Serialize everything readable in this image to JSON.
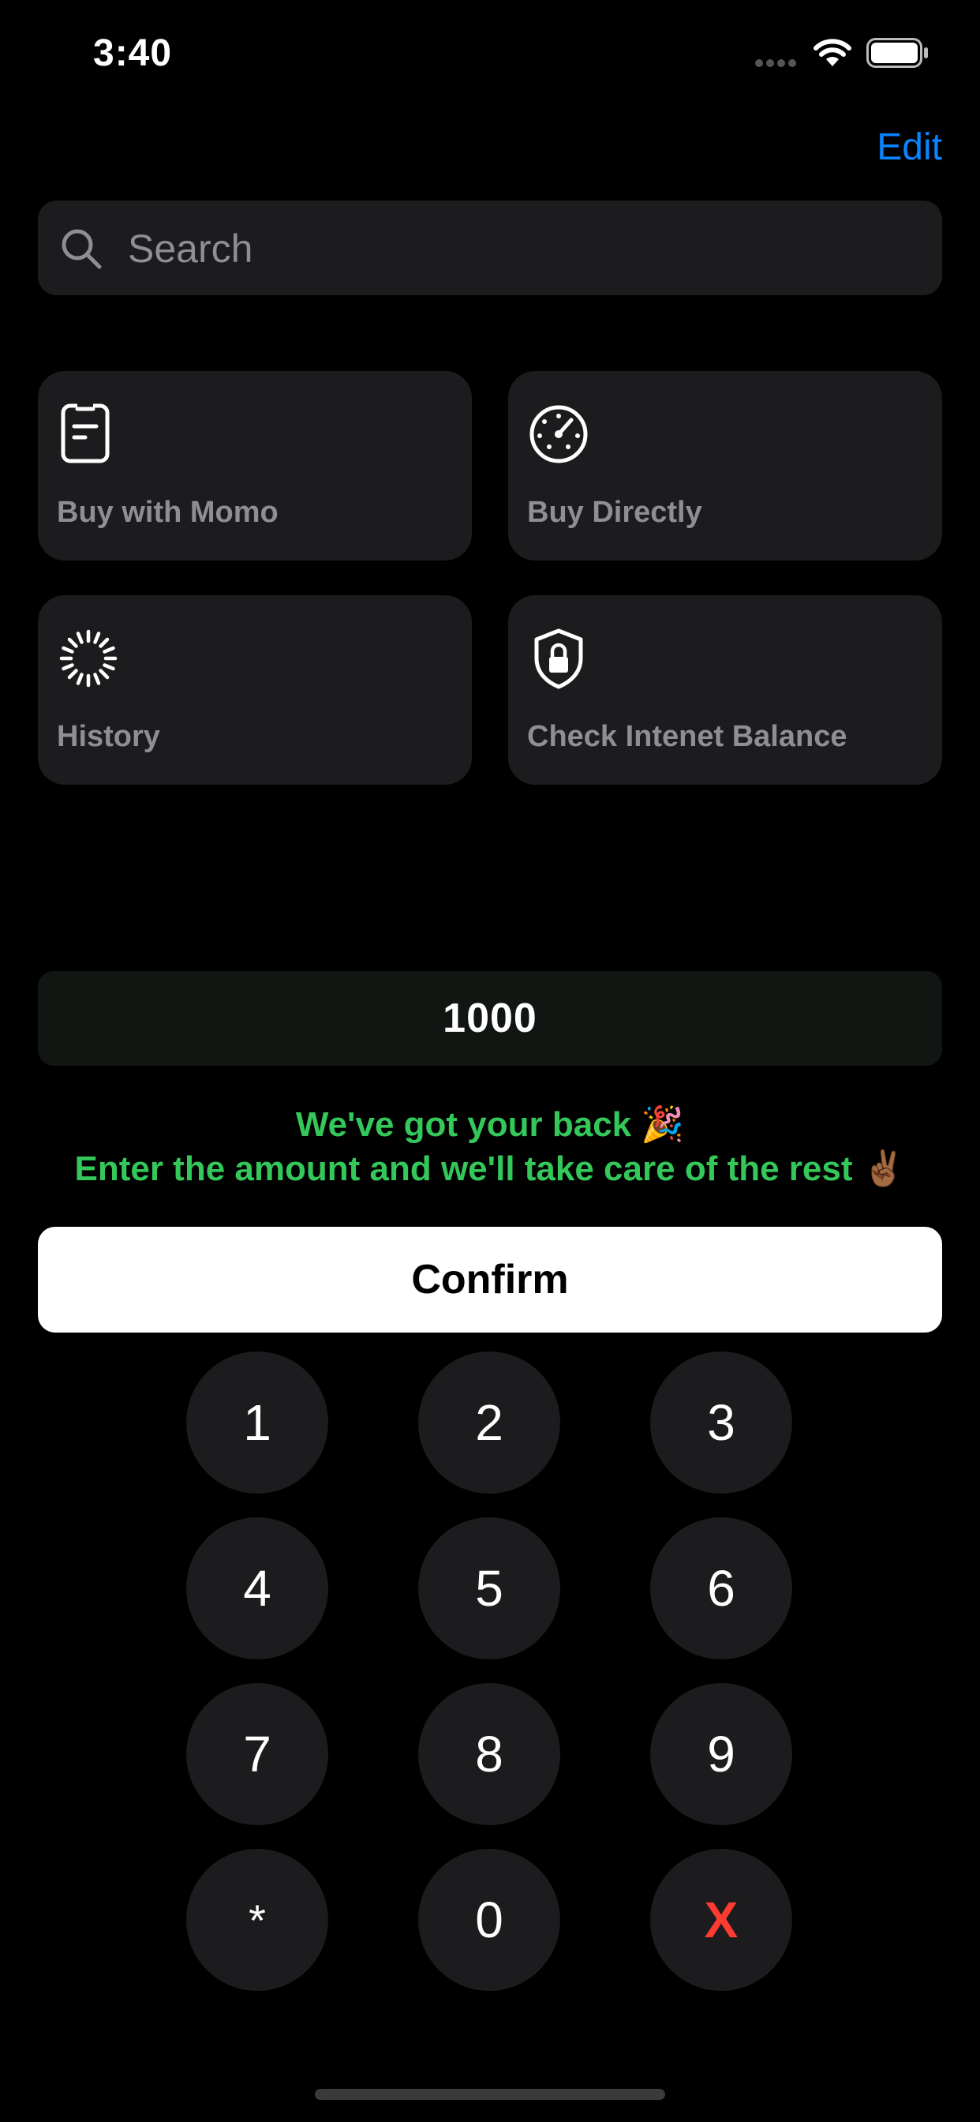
{
  "status_bar": {
    "time": "3:40",
    "icons": [
      "signal-dots-icon",
      "wifi-icon",
      "battery-icon"
    ]
  },
  "header": {
    "edit_label": "Edit"
  },
  "search": {
    "placeholder": "Search",
    "value": "",
    "icon": "search-icon"
  },
  "tiles": [
    {
      "label": "Buy with Momo",
      "icon": "clipboard-icon"
    },
    {
      "label": "Buy Directly",
      "icon": "speedometer-icon"
    },
    {
      "label": "History",
      "icon": "progress-spinner-icon"
    },
    {
      "label": "Check Intenet Balance",
      "icon": "shield-lock-icon"
    }
  ],
  "amount": {
    "value": "1000"
  },
  "message": {
    "line1": "We've got your back 🎉",
    "line2": "Enter the amount and we'll take care of the rest ✌🏾"
  },
  "confirm": {
    "label": "Confirm"
  },
  "keypad": {
    "keys": [
      "1",
      "2",
      "3",
      "4",
      "5",
      "6",
      "7",
      "8",
      "9",
      "*",
      "0",
      "X"
    ]
  },
  "colors": {
    "background": "#000000",
    "surface": "#1c1c1e",
    "accent_blue": "#0a84ff",
    "message_green": "#34c759",
    "delete_red": "#ff3b30"
  }
}
